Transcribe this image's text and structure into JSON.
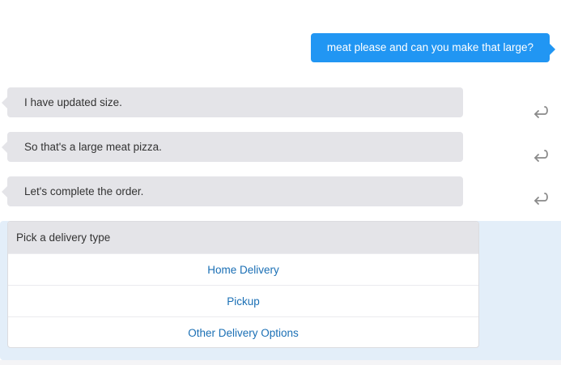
{
  "user_message": "meat please and can you make that large?",
  "bot_messages": [
    {
      "text": "I have updated size."
    },
    {
      "text": "So that's a large meat pizza."
    },
    {
      "text": "Let's complete the order."
    }
  ],
  "delivery_card": {
    "header": "Pick a delivery type",
    "options": [
      "Home Delivery",
      "Pickup",
      "Other Delivery Options"
    ]
  },
  "icons": {
    "reply": "reply-arrow-icon"
  },
  "colors": {
    "user_bubble": "#2196f3",
    "bot_bubble": "#e4e4e8",
    "card_panel": "#e3eef9",
    "option_link": "#1a6fb5"
  }
}
